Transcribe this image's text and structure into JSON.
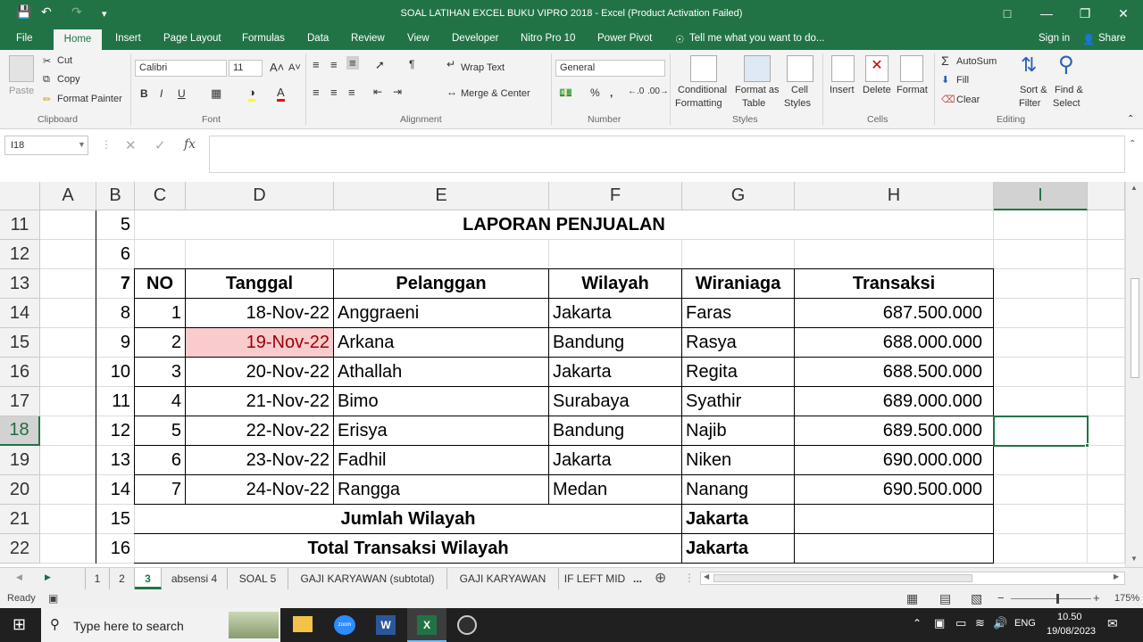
{
  "title_bar": {
    "title": "SOAL LATIHAN EXCEL BUKU VIPRO 2018 - Excel (Product Activation Failed)"
  },
  "ribbon_tabs": [
    "File",
    "Home",
    "Insert",
    "Page Layout",
    "Formulas",
    "Data",
    "Review",
    "View",
    "Developer",
    "Nitro Pro 10",
    "Power Pivot"
  ],
  "tell_me": "Tell me what you want to do...",
  "sign_in": "Sign in",
  "share": "Share",
  "clipboard": {
    "paste": "Paste",
    "cut": "Cut",
    "copy": "Copy",
    "format_painter": "Format Painter",
    "label": "Clipboard"
  },
  "font": {
    "name": "Calibri",
    "size": "11",
    "label": "Font"
  },
  "alignment": {
    "wrap": "Wrap Text",
    "merge": "Merge & Center",
    "label": "Alignment"
  },
  "number": {
    "format": "General",
    "label": "Number"
  },
  "styles": {
    "cond1": "Conditional",
    "cond2": "Formatting",
    "fat1": "Format as",
    "fat2": "Table",
    "cs1": "Cell",
    "cs2": "Styles",
    "label": "Styles"
  },
  "cells": {
    "insert": "Insert",
    "delete": "Delete",
    "format": "Format",
    "label": "Cells"
  },
  "editing": {
    "autosum": "AutoSum",
    "fill": "Fill",
    "clear": "Clear",
    "sort1": "Sort &",
    "sort2": "Filter",
    "find1": "Find &",
    "find2": "Select",
    "label": "Editing"
  },
  "name_box": "I18",
  "columns": [
    "A",
    "B",
    "C",
    "D",
    "E",
    "F",
    "G",
    "H",
    "I"
  ],
  "rows": [
    "11",
    "12",
    "13",
    "14",
    "15",
    "16",
    "17",
    "18",
    "19",
    "20",
    "21",
    "22"
  ],
  "report": {
    "title": "LAPORAN PENJUALAN",
    "b_col": [
      "5",
      "6",
      "7",
      "8",
      "9",
      "10",
      "11",
      "12",
      "13",
      "14",
      "15",
      "16"
    ],
    "headers": {
      "no": "NO",
      "tanggal": "Tanggal",
      "pelanggan": "Pelanggan",
      "wilayah": "Wilayah",
      "wiraniaga": "Wiraniaga",
      "transaksi": "Transaksi"
    },
    "data": [
      {
        "no": "1",
        "tanggal": "18-Nov-22",
        "pelanggan": "Anggraeni",
        "wilayah": "Jakarta",
        "wiraniaga": "Faras",
        "transaksi": "687.500.000"
      },
      {
        "no": "2",
        "tanggal": "19-Nov-22",
        "pelanggan": "Arkana",
        "wilayah": "Bandung",
        "wiraniaga": "Rasya",
        "transaksi": "688.000.000"
      },
      {
        "no": "3",
        "tanggal": "20-Nov-22",
        "pelanggan": "Athallah",
        "wilayah": "Jakarta",
        "wiraniaga": "Regita",
        "transaksi": "688.500.000"
      },
      {
        "no": "4",
        "tanggal": "21-Nov-22",
        "pelanggan": "Bimo",
        "wilayah": "Surabaya",
        "wiraniaga": "Syathir",
        "transaksi": "689.000.000"
      },
      {
        "no": "5",
        "tanggal": "22-Nov-22",
        "pelanggan": "Erisya",
        "wilayah": "Bandung",
        "wiraniaga": "Najib",
        "transaksi": "689.500.000"
      },
      {
        "no": "6",
        "tanggal": "23-Nov-22",
        "pelanggan": "Fadhil",
        "wilayah": "Jakarta",
        "wiraniaga": "Niken",
        "transaksi": "690.000.000"
      },
      {
        "no": "7",
        "tanggal": "24-Nov-22",
        "pelanggan": "Rangga",
        "wilayah": "Medan",
        "wiraniaga": "Nanang",
        "transaksi": "690.500.000"
      }
    ],
    "jumlah_label": "Jumlah Wilayah",
    "jumlah_val": "Jakarta",
    "total_label": "Total Transaksi Wilayah",
    "total_val": "Jakarta"
  },
  "sheet_tabs": [
    "1",
    "2",
    "3",
    "absensi 4",
    "SOAL 5",
    "GAJI KARYAWAN (subtotal)",
    "GAJI KARYAWAN",
    "IF LEFT MID"
  ],
  "sheet_more": "...",
  "status": {
    "ready": "Ready",
    "zoom": "175%"
  },
  "taskbar": {
    "search": "Type here to search",
    "lang": "ENG",
    "time": "10.50",
    "date": "19/08/2023"
  },
  "colors": {
    "excel_green": "#217346",
    "highlight": "#f8cbcc",
    "highlight_text": "#9c0006"
  }
}
